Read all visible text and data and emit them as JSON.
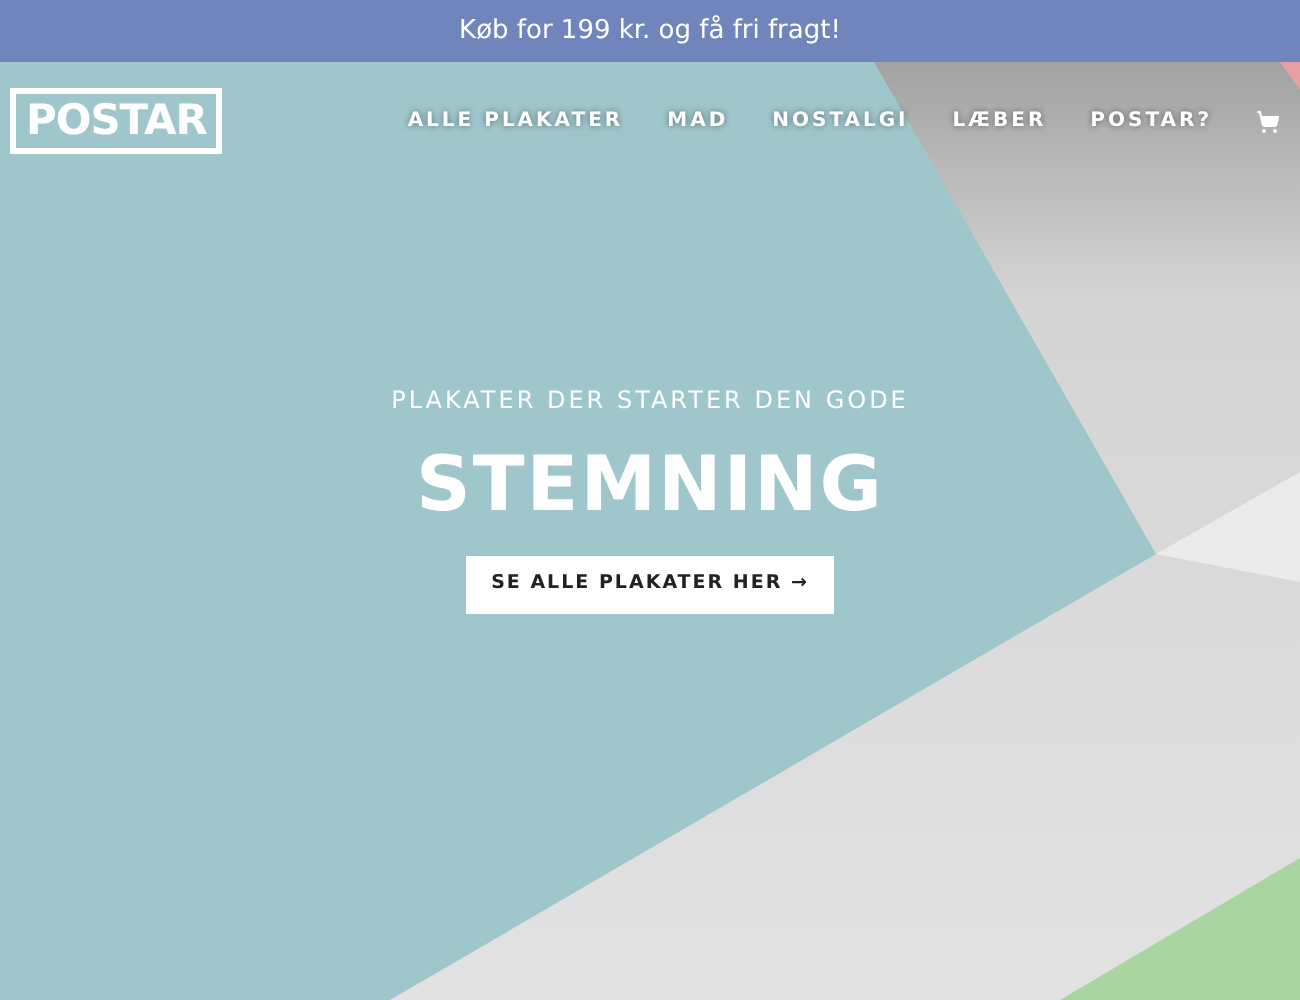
{
  "announcement": "Køb for 199 kr. og få fri fragt!",
  "logo": "POSTAR",
  "nav": [
    {
      "label": "ALLE PLAKATER"
    },
    {
      "label": "MAD"
    },
    {
      "label": "NOSTALGI"
    },
    {
      "label": "LÆBER"
    },
    {
      "label": "POSTAR?"
    }
  ],
  "hero": {
    "kind": "picture",
    "subtitle": "PLAKATER DER STARTER DEN GODE",
    "title": "STEMNING",
    "button": "SE ALLE PLAKATER HER →"
  }
}
